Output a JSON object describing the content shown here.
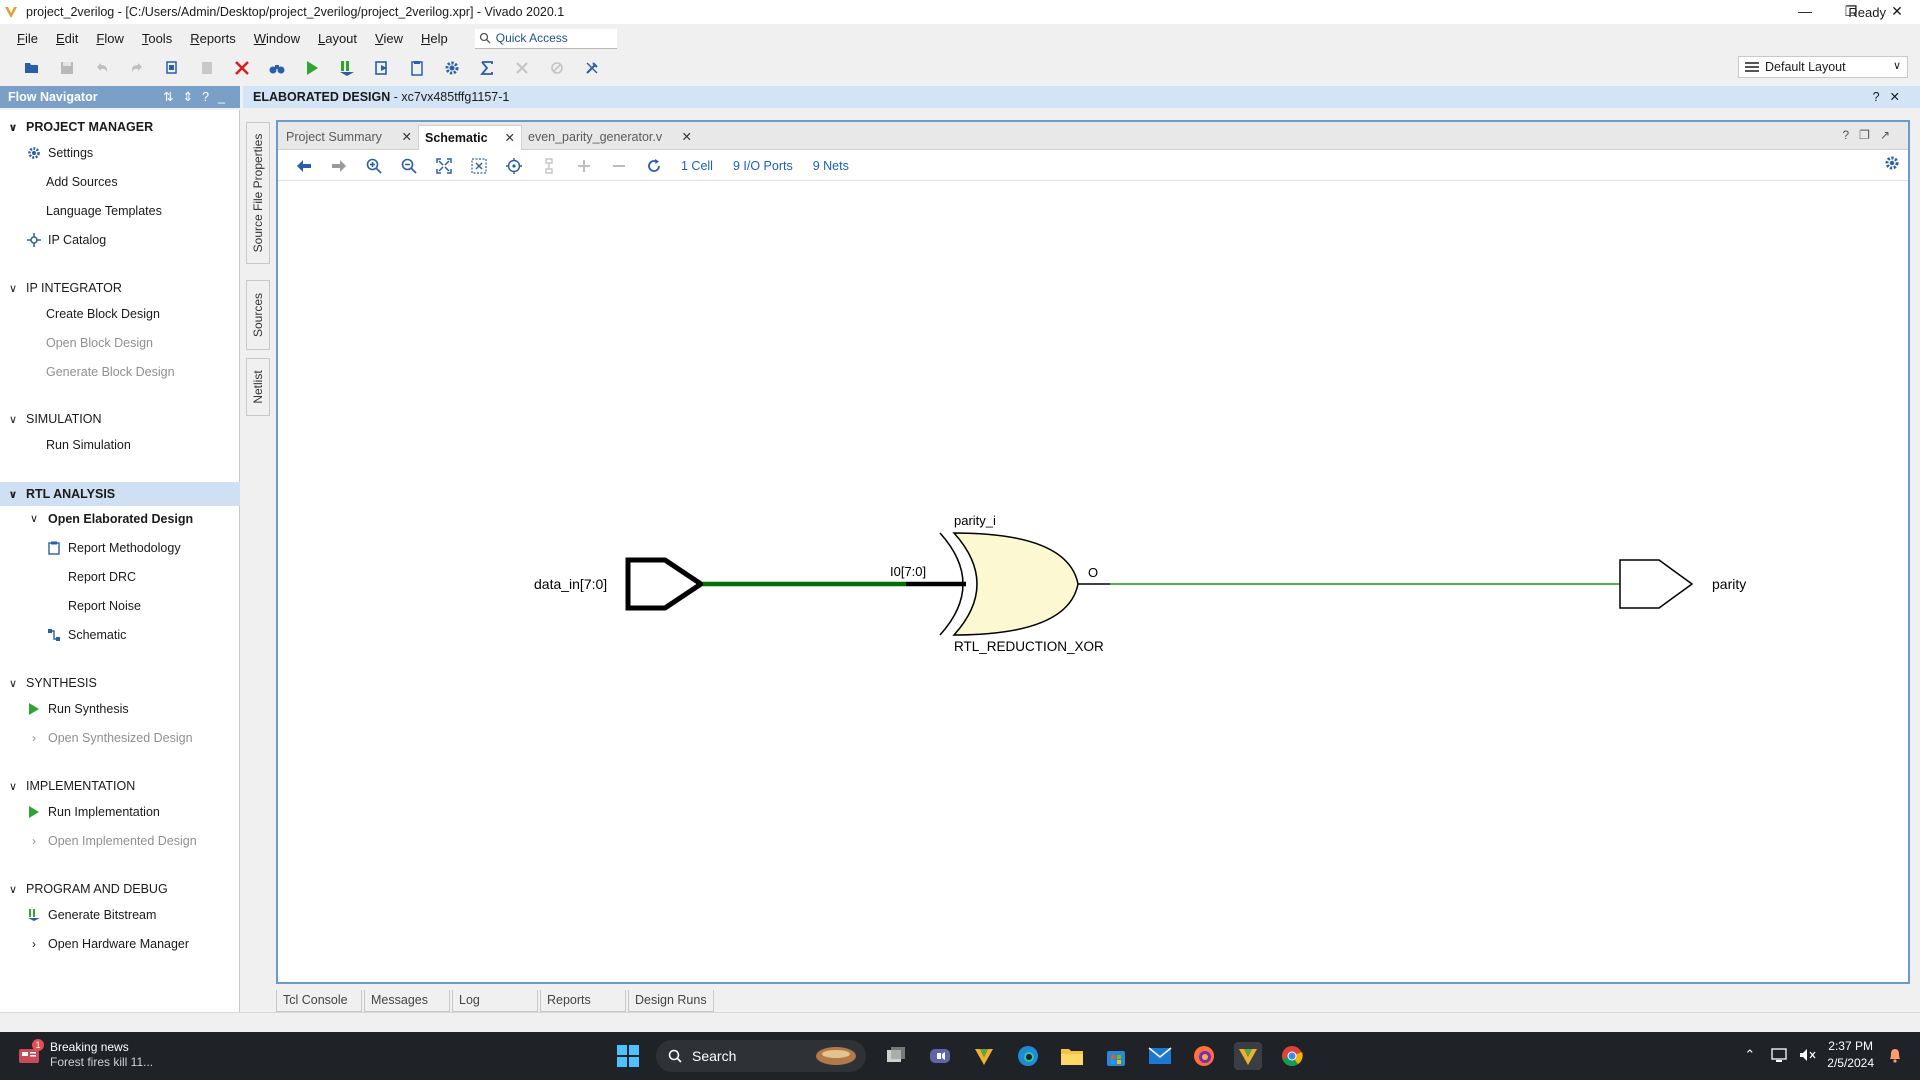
{
  "window": {
    "title": "project_2verilog - [C:/Users/Admin/Desktop/project_2verilog/project_2verilog.xpr] - Vivado 2020.1",
    "status": "Ready"
  },
  "menu": [
    "File",
    "Edit",
    "Flow",
    "Tools",
    "Reports",
    "Window",
    "Layout",
    "View",
    "Help"
  ],
  "quick_access": "Quick Access",
  "layout_select": "Default Layout",
  "flow_navigator": {
    "title": "Flow Navigator",
    "sections": {
      "project_manager": {
        "label": "PROJECT MANAGER",
        "items": [
          "Settings",
          "Add Sources",
          "Language Templates",
          "IP Catalog"
        ]
      },
      "ip_integrator": {
        "label": "IP INTEGRATOR",
        "items": [
          "Create Block Design",
          "Open Block Design",
          "Generate Block Design"
        ]
      },
      "simulation": {
        "label": "SIMULATION",
        "items": [
          "Run Simulation"
        ]
      },
      "rtl_analysis": {
        "label": "RTL ANALYSIS",
        "items": [
          "Open Elaborated Design",
          "Report Methodology",
          "Report DRC",
          "Report Noise",
          "Schematic"
        ]
      },
      "synthesis": {
        "label": "SYNTHESIS",
        "items": [
          "Run Synthesis",
          "Open Synthesized Design"
        ]
      },
      "implementation": {
        "label": "IMPLEMENTATION",
        "items": [
          "Run Implementation",
          "Open Implemented Design"
        ]
      },
      "program_debug": {
        "label": "PROGRAM AND DEBUG",
        "items": [
          "Generate Bitstream",
          "Open Hardware Manager"
        ]
      }
    }
  },
  "elaborated": {
    "label": "ELABORATED DESIGN",
    "part": " - xc7vx485tffg1157-1"
  },
  "side_tabs": [
    "Source File Properties",
    "Sources",
    "Netlist"
  ],
  "tabs": [
    "Project Summary",
    "Schematic",
    "even_parity_generator.v"
  ],
  "schematic_toolbar": {
    "cells": "1 Cell",
    "ports": "9 I/O Ports",
    "nets": "9 Nets"
  },
  "schematic": {
    "input_port": "data_in[7:0]",
    "cell_name": "parity_i",
    "cell_pin_in": "I0[7:0]",
    "cell_pin_out": "O",
    "cell_type": "RTL_REDUCTION_XOR",
    "output_port": "parity",
    "colors": {
      "bus_net": "#007000",
      "net": "#33aa33",
      "gate_fill": "#fcf8d2"
    }
  },
  "bottom_tabs": [
    "Tcl Console",
    "Messages",
    "Log",
    "Reports",
    "Design Runs"
  ],
  "taskbar": {
    "news_title": "Breaking news",
    "news_text": "Forest fires kill 11...",
    "news_badge": "1",
    "search": "Search",
    "time": "2:37 PM",
    "date": "2/5/2024"
  }
}
